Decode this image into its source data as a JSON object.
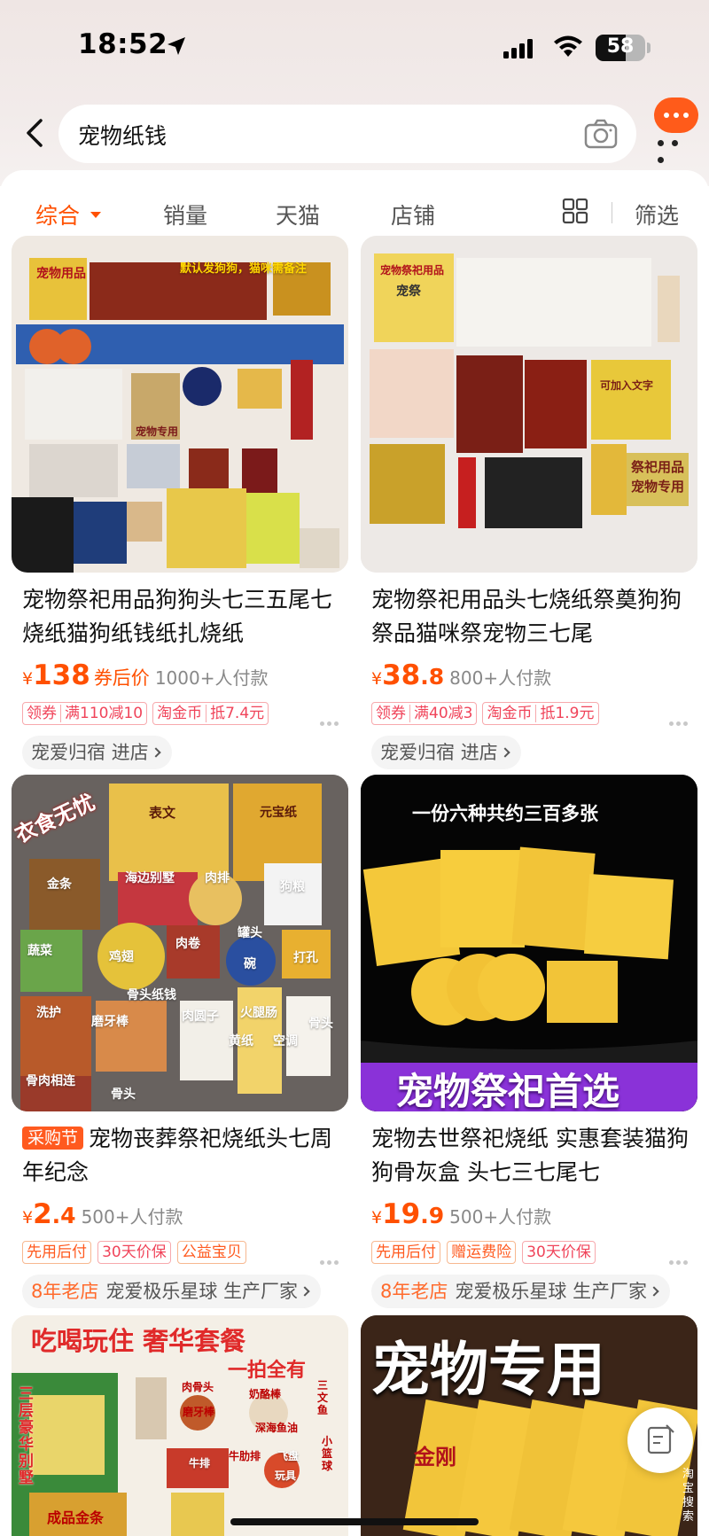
{
  "status_bar": {
    "time": "18:52",
    "battery": "58"
  },
  "search": {
    "query": "宠物纸钱"
  },
  "tabs": {
    "items": [
      "综合",
      "销量",
      "天猫",
      "店铺"
    ],
    "filter": "筛选"
  },
  "products": [
    {
      "title": "宠物祭祀用品狗狗头七三五尾七烧纸猫狗纸钱纸扎烧纸",
      "price_int": "138",
      "price_dec": "",
      "price_note": "券后价",
      "sales": "1000+人付款",
      "badges": {
        "coupon": "领券",
        "coupon_value": "满110减10",
        "coin": "淘金币",
        "coin_value": "抵7.4元"
      },
      "shop": {
        "name": "宠爱归宿",
        "enter": "进店"
      }
    },
    {
      "title": "宠物祭祀用品头七烧纸祭奠狗狗祭品猫咪祭宠物三七尾",
      "price_int": "38",
      "price_dec": ".8",
      "price_note": "",
      "sales": "800+人付款",
      "badges": {
        "coupon": "领券",
        "coupon_value": "满40减3",
        "coin": "淘金币",
        "coin_value": "抵1.9元"
      },
      "shop": {
        "name": "宠爱归宿",
        "enter": "进店"
      }
    },
    {
      "tag": "采购节",
      "title": "宠物丧葬祭祀烧纸头七周年纪念",
      "price_int": "2",
      "price_dec": ".4",
      "price_note": "",
      "sales": "500+人付款",
      "badges": [
        "先用后付",
        "30天价保",
        "公益宝贝"
      ],
      "shop": {
        "years": "8年老店",
        "name": "宠爱极乐星球",
        "enter": "生产厂家"
      }
    },
    {
      "title": "宠物去世祭祀烧纸 实惠套装猫狗狗骨灰盒 头七三七尾七",
      "price_int": "19",
      "price_dec": ".9",
      "price_note": "",
      "sales": "500+人付款",
      "badges": [
        "先用后付",
        "赠运费险",
        "30天价保"
      ],
      "shop": {
        "years": "8年老店",
        "name": "宠爱极乐星球",
        "enter": "生产厂家"
      }
    }
  ],
  "image_text": {
    "p1_a": "宠物用品",
    "p1_b": "默认发狗狗，猫咪需备注",
    "p1_c": "宠物专用",
    "p2_a": "宠物祭祀用品",
    "p2_b": "宠祭",
    "p2_c": "祭祀用品",
    "p2_d": "宠物专用",
    "p2_e": "可加入文字",
    "p3_a": "衣食无忧",
    "p3_b": "表文",
    "p3_c": "元宝纸",
    "p3_d": "金条",
    "p3_e": "海边别墅",
    "p3_f": "肉排",
    "p3_g": "狗粮",
    "p3_h": "蔬菜",
    "p3_i": "鸡翅",
    "p3_j": "肉卷",
    "p3_k": "罐头",
    "p3_l": "碗",
    "p3_m": "打孔",
    "p3_n": "洗护",
    "p3_o": "骨头纸钱",
    "p3_p": "磨牙棒",
    "p3_q": "肉圆子",
    "p3_r": "火腿肠",
    "p3_s": "骨头",
    "p3_t": "黄纸",
    "p3_u": "空调",
    "p3_v": "骨肉相连",
    "p3_w": "骨头",
    "p4_a": "一份六种共约三百多张",
    "p4_b": "宠物祭祀首选",
    "p5_a": "吃喝玩住 奢华套餐",
    "p5_b": "一拍全有",
    "p5_c": "三层豪华别墅",
    "p5_d": "肉骨头",
    "p5_e": "奶酪棒",
    "p5_f": "三文鱼",
    "p5_g": "磨牙棒",
    "p5_h": "深海鱼油",
    "p5_i": "牛排",
    "p5_j": "牛肋排",
    "p5_k": "飞盘",
    "p5_l": "玩具",
    "p5_m": "小篮球",
    "p5_n": "成品金条",
    "p6_a": "宠物专用",
    "p6_b": "金刚",
    "side": "淘宝搜索"
  },
  "colors": {
    "accent": "#ff5000",
    "msg_button": "#ff5b1a"
  }
}
